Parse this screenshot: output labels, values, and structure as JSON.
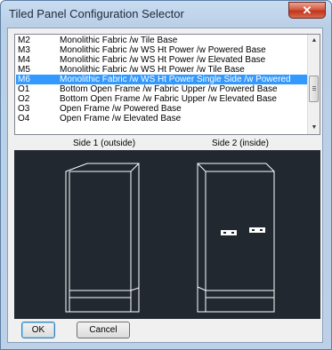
{
  "window": {
    "title": "Tiled Panel Configuration Selector",
    "close_glyph": "✕"
  },
  "list": {
    "items": [
      {
        "code": "M2",
        "desc": "Monolithic Fabric /w Tile Base",
        "selected": false
      },
      {
        "code": "M3",
        "desc": "Monolithic Fabric /w WS Ht Power /w Powered Base",
        "selected": false
      },
      {
        "code": "M4",
        "desc": "Monolithic Fabric /w WS Ht Power /w Elevated Base",
        "selected": false
      },
      {
        "code": "M5",
        "desc": "Monolithic Fabric /w WS Ht Power /w Tile Base",
        "selected": false
      },
      {
        "code": "M6",
        "desc": "Monolithic Fabric /w WS Ht Power Single Side /w Powered",
        "selected": true
      },
      {
        "code": "O1",
        "desc": "Bottom Open Frame /w Fabric Upper /w Powered Base",
        "selected": false
      },
      {
        "code": "O2",
        "desc": "Bottom Open Frame /w Fabric Upper /w Elevated Base",
        "selected": false
      },
      {
        "code": "O3",
        "desc": "Open Frame /w Powered Base",
        "selected": false
      },
      {
        "code": "O4",
        "desc": "Open Frame /w Elevated Base",
        "selected": false
      }
    ],
    "scroll_up_glyph": "▲",
    "scroll_down_glyph": "▼"
  },
  "preview": {
    "side1_label": "Side 1 (outside)",
    "side2_label": "Side 2 (inside)"
  },
  "buttons": {
    "ok_label": "OK",
    "cancel_label": "Cancel"
  },
  "colors": {
    "selection": "#3399ff",
    "preview_bg": "#212830",
    "line": "#ffffff"
  }
}
